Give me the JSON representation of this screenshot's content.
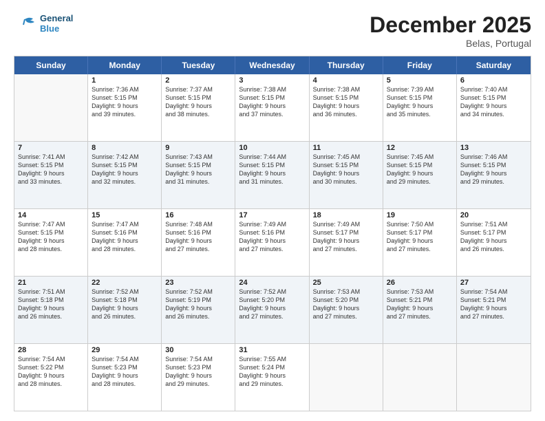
{
  "logo": {
    "line1": "General",
    "line2": "Blue"
  },
  "title": "December 2025",
  "location": "Belas, Portugal",
  "days_of_week": [
    "Sunday",
    "Monday",
    "Tuesday",
    "Wednesday",
    "Thursday",
    "Friday",
    "Saturday"
  ],
  "weeks": [
    [
      {
        "day": "",
        "lines": [],
        "empty": true
      },
      {
        "day": "1",
        "lines": [
          "Sunrise: 7:36 AM",
          "Sunset: 5:15 PM",
          "Daylight: 9 hours",
          "and 39 minutes."
        ]
      },
      {
        "day": "2",
        "lines": [
          "Sunrise: 7:37 AM",
          "Sunset: 5:15 PM",
          "Daylight: 9 hours",
          "and 38 minutes."
        ]
      },
      {
        "day": "3",
        "lines": [
          "Sunrise: 7:38 AM",
          "Sunset: 5:15 PM",
          "Daylight: 9 hours",
          "and 37 minutes."
        ]
      },
      {
        "day": "4",
        "lines": [
          "Sunrise: 7:38 AM",
          "Sunset: 5:15 PM",
          "Daylight: 9 hours",
          "and 36 minutes."
        ]
      },
      {
        "day": "5",
        "lines": [
          "Sunrise: 7:39 AM",
          "Sunset: 5:15 PM",
          "Daylight: 9 hours",
          "and 35 minutes."
        ]
      },
      {
        "day": "6",
        "lines": [
          "Sunrise: 7:40 AM",
          "Sunset: 5:15 PM",
          "Daylight: 9 hours",
          "and 34 minutes."
        ]
      }
    ],
    [
      {
        "day": "7",
        "lines": [
          "Sunrise: 7:41 AM",
          "Sunset: 5:15 PM",
          "Daylight: 9 hours",
          "and 33 minutes."
        ]
      },
      {
        "day": "8",
        "lines": [
          "Sunrise: 7:42 AM",
          "Sunset: 5:15 PM",
          "Daylight: 9 hours",
          "and 32 minutes."
        ]
      },
      {
        "day": "9",
        "lines": [
          "Sunrise: 7:43 AM",
          "Sunset: 5:15 PM",
          "Daylight: 9 hours",
          "and 31 minutes."
        ]
      },
      {
        "day": "10",
        "lines": [
          "Sunrise: 7:44 AM",
          "Sunset: 5:15 PM",
          "Daylight: 9 hours",
          "and 31 minutes."
        ]
      },
      {
        "day": "11",
        "lines": [
          "Sunrise: 7:45 AM",
          "Sunset: 5:15 PM",
          "Daylight: 9 hours",
          "and 30 minutes."
        ]
      },
      {
        "day": "12",
        "lines": [
          "Sunrise: 7:45 AM",
          "Sunset: 5:15 PM",
          "Daylight: 9 hours",
          "and 29 minutes."
        ]
      },
      {
        "day": "13",
        "lines": [
          "Sunrise: 7:46 AM",
          "Sunset: 5:15 PM",
          "Daylight: 9 hours",
          "and 29 minutes."
        ]
      }
    ],
    [
      {
        "day": "14",
        "lines": [
          "Sunrise: 7:47 AM",
          "Sunset: 5:15 PM",
          "Daylight: 9 hours",
          "and 28 minutes."
        ]
      },
      {
        "day": "15",
        "lines": [
          "Sunrise: 7:47 AM",
          "Sunset: 5:16 PM",
          "Daylight: 9 hours",
          "and 28 minutes."
        ]
      },
      {
        "day": "16",
        "lines": [
          "Sunrise: 7:48 AM",
          "Sunset: 5:16 PM",
          "Daylight: 9 hours",
          "and 27 minutes."
        ]
      },
      {
        "day": "17",
        "lines": [
          "Sunrise: 7:49 AM",
          "Sunset: 5:16 PM",
          "Daylight: 9 hours",
          "and 27 minutes."
        ]
      },
      {
        "day": "18",
        "lines": [
          "Sunrise: 7:49 AM",
          "Sunset: 5:17 PM",
          "Daylight: 9 hours",
          "and 27 minutes."
        ]
      },
      {
        "day": "19",
        "lines": [
          "Sunrise: 7:50 AM",
          "Sunset: 5:17 PM",
          "Daylight: 9 hours",
          "and 27 minutes."
        ]
      },
      {
        "day": "20",
        "lines": [
          "Sunrise: 7:51 AM",
          "Sunset: 5:17 PM",
          "Daylight: 9 hours",
          "and 26 minutes."
        ]
      }
    ],
    [
      {
        "day": "21",
        "lines": [
          "Sunrise: 7:51 AM",
          "Sunset: 5:18 PM",
          "Daylight: 9 hours",
          "and 26 minutes."
        ]
      },
      {
        "day": "22",
        "lines": [
          "Sunrise: 7:52 AM",
          "Sunset: 5:18 PM",
          "Daylight: 9 hours",
          "and 26 minutes."
        ]
      },
      {
        "day": "23",
        "lines": [
          "Sunrise: 7:52 AM",
          "Sunset: 5:19 PM",
          "Daylight: 9 hours",
          "and 26 minutes."
        ]
      },
      {
        "day": "24",
        "lines": [
          "Sunrise: 7:52 AM",
          "Sunset: 5:20 PM",
          "Daylight: 9 hours",
          "and 27 minutes."
        ]
      },
      {
        "day": "25",
        "lines": [
          "Sunrise: 7:53 AM",
          "Sunset: 5:20 PM",
          "Daylight: 9 hours",
          "and 27 minutes."
        ]
      },
      {
        "day": "26",
        "lines": [
          "Sunrise: 7:53 AM",
          "Sunset: 5:21 PM",
          "Daylight: 9 hours",
          "and 27 minutes."
        ]
      },
      {
        "day": "27",
        "lines": [
          "Sunrise: 7:54 AM",
          "Sunset: 5:21 PM",
          "Daylight: 9 hours",
          "and 27 minutes."
        ]
      }
    ],
    [
      {
        "day": "28",
        "lines": [
          "Sunrise: 7:54 AM",
          "Sunset: 5:22 PM",
          "Daylight: 9 hours",
          "and 28 minutes."
        ]
      },
      {
        "day": "29",
        "lines": [
          "Sunrise: 7:54 AM",
          "Sunset: 5:23 PM",
          "Daylight: 9 hours",
          "and 28 minutes."
        ]
      },
      {
        "day": "30",
        "lines": [
          "Sunrise: 7:54 AM",
          "Sunset: 5:23 PM",
          "Daylight: 9 hours",
          "and 29 minutes."
        ]
      },
      {
        "day": "31",
        "lines": [
          "Sunrise: 7:55 AM",
          "Sunset: 5:24 PM",
          "Daylight: 9 hours",
          "and 29 minutes."
        ]
      },
      {
        "day": "",
        "lines": [],
        "empty": true
      },
      {
        "day": "",
        "lines": [],
        "empty": true
      },
      {
        "day": "",
        "lines": [],
        "empty": true
      }
    ]
  ]
}
